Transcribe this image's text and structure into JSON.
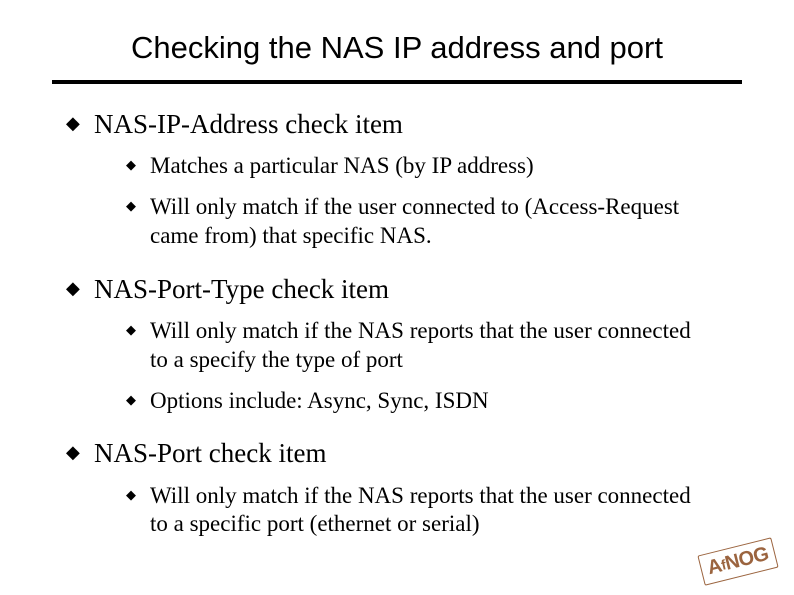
{
  "slide": {
    "title": "Checking the NAS IP address and port",
    "bullets": [
      {
        "text": "NAS-IP-Address check item",
        "sub": [
          "Matches a particular NAS (by IP address)",
          "Will only match if the user connected to (Access-Request came from) that specific NAS."
        ]
      },
      {
        "text": "NAS-Port-Type check item",
        "sub": [
          "Will only match if the NAS reports that the user connected to a specify the type of port",
          "Options include: Async, Sync, ISDN"
        ]
      },
      {
        "text": "NAS-Port check item",
        "sub": [
          "Will only match if the NAS reports that the user connected to a specific port (ethernet or serial)"
        ]
      }
    ],
    "logo": {
      "prefix": "A",
      "small": "f",
      "suffix": "NOG"
    }
  }
}
